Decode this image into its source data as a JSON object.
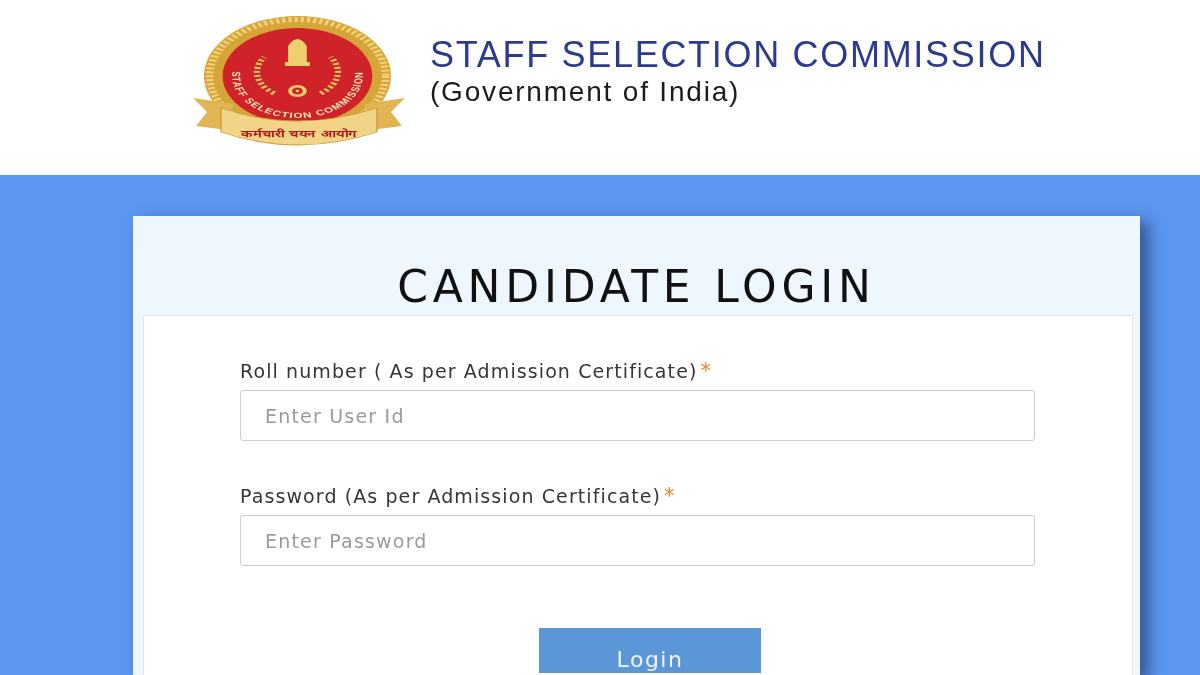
{
  "header": {
    "logo": {
      "ring_text": "STAFF SELECTION COMMISSION",
      "ribbon_text": "कर्मचारी चयन आयोग"
    },
    "title": "STAFF SELECTION COMMISSION",
    "subtitle": "(Government of India)"
  },
  "login_card": {
    "title": "CANDIDATE LOGIN",
    "fields": [
      {
        "label": "Roll number ( As per Admission Certificate)",
        "required_mark": "*",
        "placeholder": "Enter User Id"
      },
      {
        "label": "Password (As per Admission Certificate)",
        "required_mark": "*",
        "placeholder": "Enter Password"
      }
    ],
    "submit_button": "Login"
  }
}
